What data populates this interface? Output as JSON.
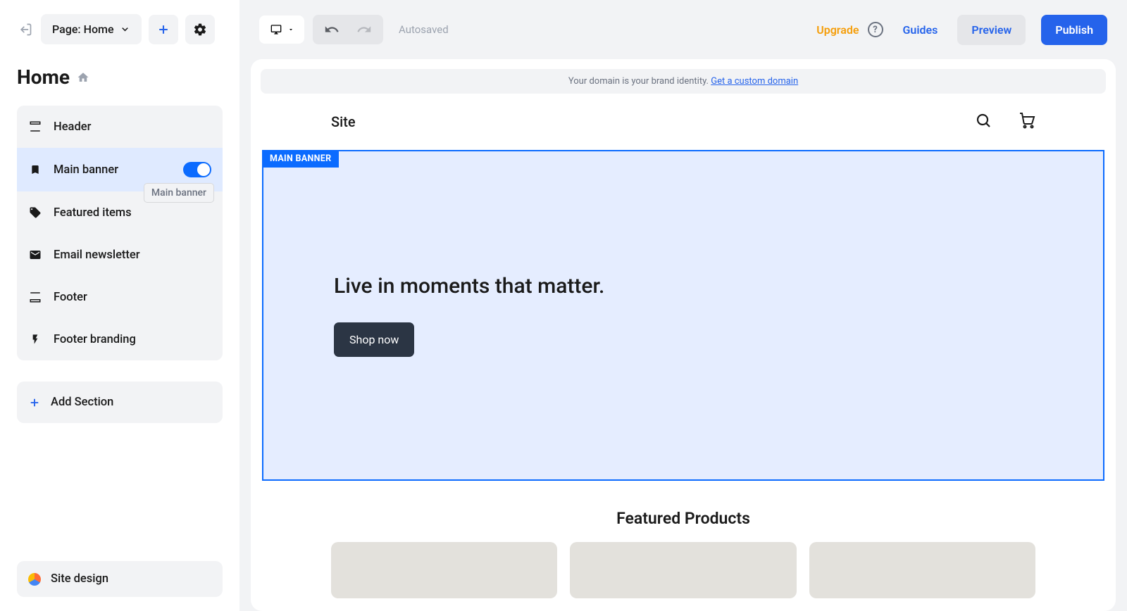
{
  "sidebar": {
    "page_selector_label": "Page: Home",
    "page_title": "Home",
    "sections": [
      {
        "label": "Header"
      },
      {
        "label": "Main banner",
        "tooltip": "Main banner"
      },
      {
        "label": "Featured items"
      },
      {
        "label": "Email newsletter"
      },
      {
        "label": "Footer"
      },
      {
        "label": "Footer branding"
      }
    ],
    "add_section_label": "Add Section",
    "site_design_label": "Site design"
  },
  "topbar": {
    "autosaved_label": "Autosaved",
    "upgrade_label": "Upgrade",
    "guides_label": "Guides",
    "preview_label": "Preview",
    "publish_label": "Publish"
  },
  "preview": {
    "domain_notice_text": "Your domain is your brand identity. ",
    "domain_notice_link": "Get a custom domain",
    "site_name": "Site",
    "main_banner": {
      "tag": "MAIN BANNER",
      "heading": "Live in moments that matter.",
      "cta": "Shop now"
    },
    "featured_title": "Featured Products"
  }
}
